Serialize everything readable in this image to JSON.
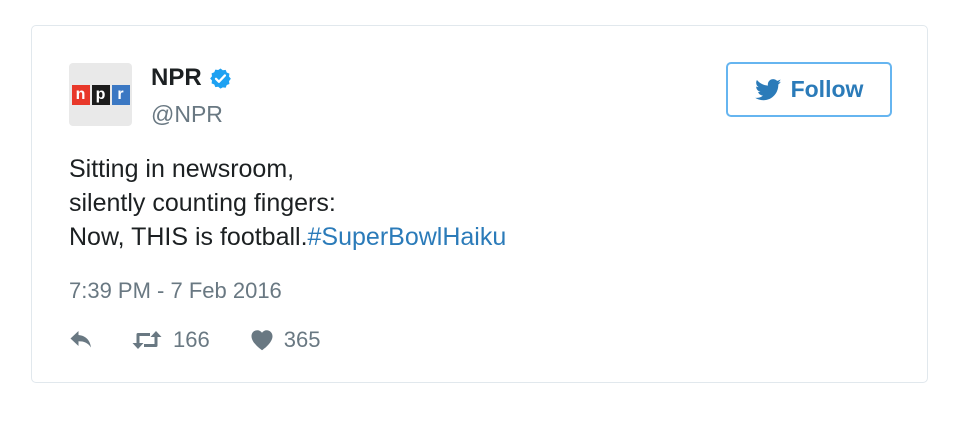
{
  "account": {
    "display_name": "NPR",
    "handle": "@NPR",
    "verified": true,
    "logo_letters": [
      "n",
      "p",
      "r"
    ]
  },
  "follow_button": {
    "label": "Follow"
  },
  "tweet": {
    "lines": [
      "Sitting in newsroom,",
      "silently counting fingers:",
      "Now, THIS is football."
    ],
    "hashtag": "#SuperBowlHaiku",
    "timestamp": "7:39 PM - 7 Feb 2016"
  },
  "stats": {
    "retweets": "166",
    "likes": "365"
  },
  "icons": {
    "verified": "verified-badge-icon",
    "follow": "twitter-bird-icon",
    "reply": "reply-icon",
    "retweet": "retweet-icon",
    "like": "heart-icon"
  },
  "colors": {
    "link": "#2b7bb9",
    "verified": "#1da1f2",
    "muted": "#697882",
    "border": "#e1e8ed",
    "follow_border": "#66b5f0"
  }
}
